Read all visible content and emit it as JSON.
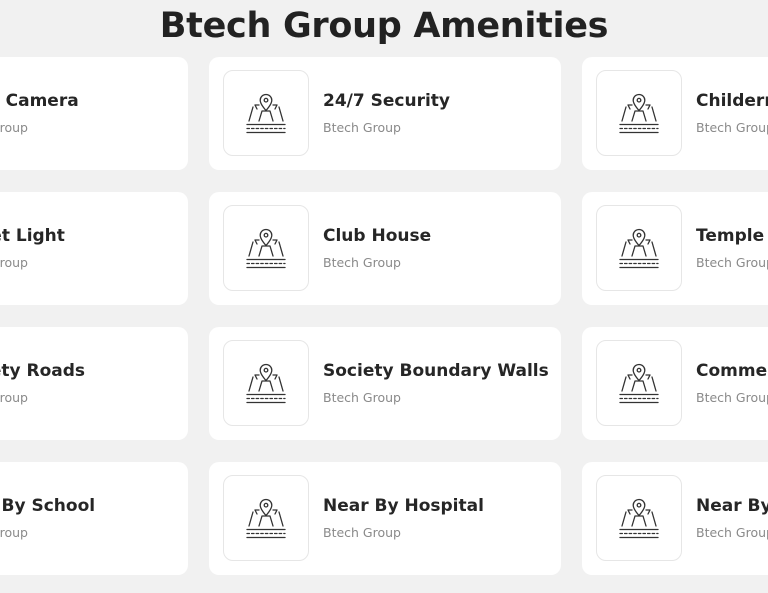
{
  "page": {
    "title": "Btech Group Amenities"
  },
  "amenities": [
    {
      "title": "CCTV Camera",
      "subtitle": "Btech Group"
    },
    {
      "title": "24/7 Security",
      "subtitle": "Btech Group"
    },
    {
      "title": "Childern Play Area",
      "subtitle": "Btech Group"
    },
    {
      "title": "Street Light",
      "subtitle": "Btech Group"
    },
    {
      "title": "Club House",
      "subtitle": "Btech Group"
    },
    {
      "title": "Temple",
      "subtitle": "Btech Group"
    },
    {
      "title": "Society Roads",
      "subtitle": "Btech Group"
    },
    {
      "title": "Society Boundary Walls",
      "subtitle": "Btech Group"
    },
    {
      "title": "Commercial Shops",
      "subtitle": "Btech Group"
    },
    {
      "title": "Near By School",
      "subtitle": "Btech Group"
    },
    {
      "title": "Near By Hospital",
      "subtitle": "Btech Group"
    },
    {
      "title": "Near By Market",
      "subtitle": "Btech Group"
    }
  ],
  "icon": "location-road-icon",
  "colors": {
    "background": "#f1f1f1",
    "card": "#ffffff",
    "title": "#262626",
    "subtitle": "#8a8a8a"
  }
}
